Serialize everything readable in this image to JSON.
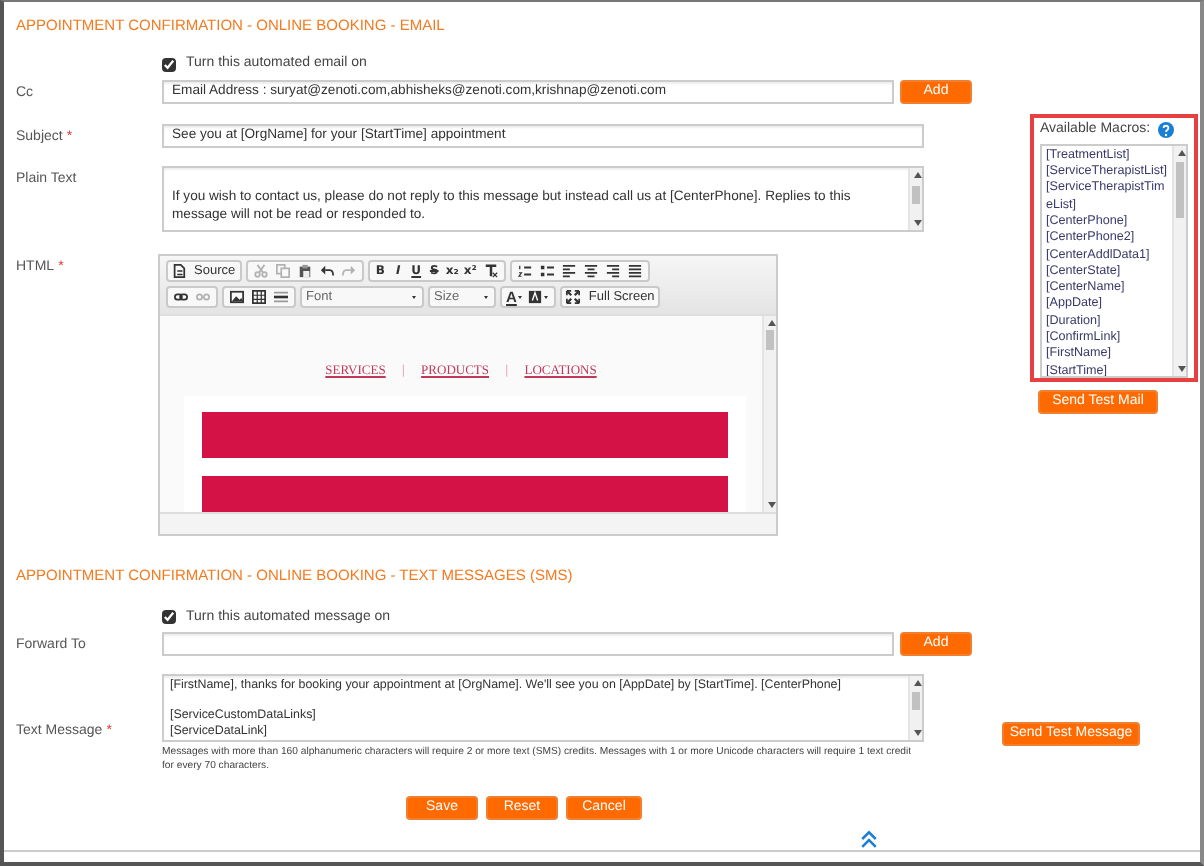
{
  "email_section": {
    "title": "APPOINTMENT CONFIRMATION - ONLINE BOOKING - EMAIL",
    "toggle": {
      "label": "Turn this automated email on",
      "checked": true
    },
    "cc": {
      "label": "Cc",
      "value": "Email Address : suryat@zenoti.com,abhisheks@zenoti.com,krishnap@zenoti.com",
      "button": "Add"
    },
    "subject": {
      "label": "Subject",
      "required_mark": "*",
      "value": "See you at [OrgName] for your [StartTime] appointment"
    },
    "plain_text": {
      "label": "Plain Text",
      "value": "If you wish to contact us, please do not reply to this message but instead call us at [CenterPhone]. Replies to this message will not be read or responded to."
    },
    "html": {
      "label": "HTML",
      "required_mark": "*",
      "editor": {
        "toolbar": [
          [
            [
              {
                "kind": "icon-label",
                "label": "Source"
              }
            ],
            [
              {
                "kind": "icon",
                "disabled": true
              },
              {
                "kind": "icon",
                "disabled": true
              },
              {
                "kind": "icon",
                "disabled": false
              },
              {
                "kind": "icon",
                "disabled": false
              },
              {
                "kind": "icon",
                "disabled": true
              }
            ],
            [
              {
                "kind": "glyph",
                "label": "B"
              },
              {
                "kind": "glyph",
                "label": "I"
              },
              {
                "kind": "glyph",
                "label": "U"
              },
              {
                "kind": "glyph",
                "label": "S"
              },
              {
                "kind": "glyph",
                "label": "x₂"
              },
              {
                "kind": "glyph",
                "label": "x²"
              },
              {
                "kind": "icon",
                "disabled": false
              }
            ],
            [
              {
                "kind": "icon",
                "disabled": false
              },
              {
                "kind": "icon",
                "disabled": false
              },
              {
                "kind": "icon",
                "disabled": false
              },
              {
                "kind": "icon",
                "disabled": false
              },
              {
                "kind": "icon",
                "disabled": false
              },
              {
                "kind": "icon",
                "disabled": false
              }
            ]
          ],
          [
            [
              {
                "kind": "icon",
                "disabled": false
              },
              {
                "kind": "icon",
                "disabled": true
              }
            ],
            [
              {
                "kind": "icon",
                "disabled": false
              },
              {
                "kind": "icon",
                "disabled": false
              },
              {
                "kind": "icon",
                "disabled": false
              }
            ],
            [
              {
                "kind": "combo",
                "label": "Font"
              }
            ],
            [
              {
                "kind": "combo",
                "label": "Size"
              }
            ],
            [
              {
                "kind": "color-glyph",
                "label": "A"
              },
              {
                "kind": "color-icon",
                "disabled": false
              }
            ],
            [
              {
                "kind": "icon-label",
                "label": "Full Screen"
              }
            ]
          ]
        ],
        "nav": [
          {
            "kind": "link",
            "text": "SERVICES"
          },
          {
            "kind": "separator",
            "text": "|"
          },
          {
            "kind": "link",
            "text": "PRODUCTS"
          },
          {
            "kind": "separator",
            "text": "|"
          },
          {
            "kind": "link",
            "text": "LOCATIONS"
          }
        ]
      }
    }
  },
  "macros": {
    "label": "Available Macros:",
    "items": [
      "[TreatmentList]",
      "[ServiceTherapistList]",
      "[ServiceTherapistTimeList]",
      "[CenterPhone]",
      "[CenterPhone2]",
      "[CenterAddlData1]",
      "[CenterState]",
      "[CenterName]",
      "[AppDate]",
      "[Duration]",
      "[ConfirmLink]",
      "[FirstName]",
      "[StartTime]"
    ],
    "send_button": "Send Test Mail"
  },
  "sms_section": {
    "title": "APPOINTMENT CONFIRMATION - ONLINE BOOKING - TEXT MESSAGES (SMS)",
    "toggle": {
      "label": "Turn this automated message on",
      "checked": true
    },
    "forward_to": {
      "label": "Forward To",
      "button": "Add"
    },
    "text_message": {
      "label": "Text Message",
      "required_mark": "*",
      "value": "[FirstName], thanks for booking your appointment at [OrgName]. We'll see you on [AppDate] by [StartTime]. [CenterPhone]\n\n[ServiceCustomDataLinks]\n[ServiceDataLink]",
      "note": "Messages with more than 160 alphanumeric characters will require 2 or more text (SMS) credits. Messages with 1 or more Unicode characters will require 1 text credit for every 70 characters."
    },
    "send_button": "Send Test Message"
  },
  "actions": [
    "Save",
    "Reset",
    "Cancel"
  ]
}
